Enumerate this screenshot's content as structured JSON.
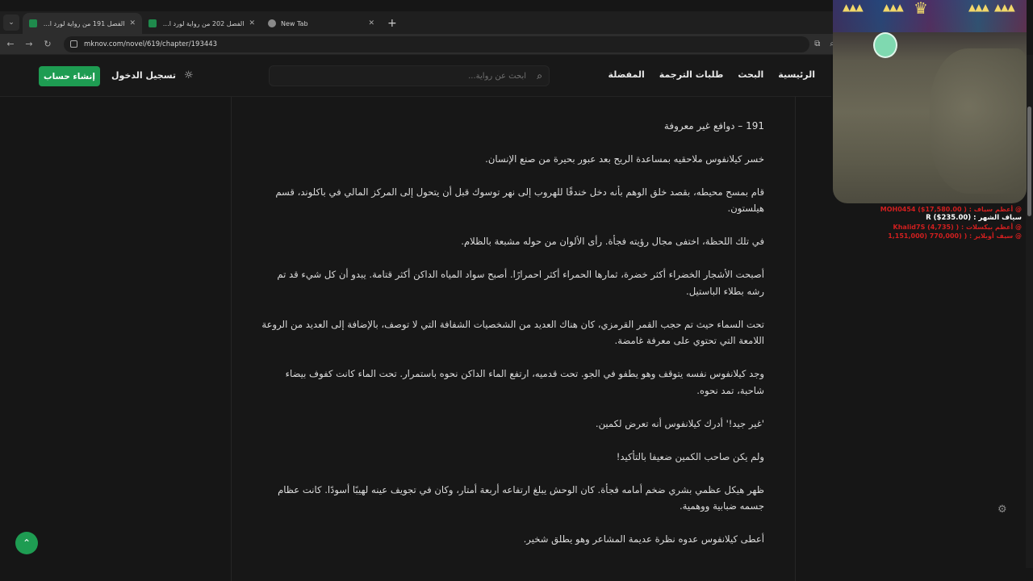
{
  "browser": {
    "tabs": [
      {
        "title": "الفصل 191 من رواية لورد الفوا...",
        "active": true
      },
      {
        "title": "الفصل 202 من رواية لورد الفوا...",
        "active": false
      },
      {
        "title": "New Tab",
        "active": false
      }
    ],
    "url": "mknov.com/novel/619/chapter/193443"
  },
  "header": {
    "menu": [
      "الرئيسية",
      "البحث",
      "طلبات الترجمة",
      "المفضلة"
    ],
    "search_placeholder": "ابحث عن رواية...",
    "login": "تسجيل الدخول",
    "register": "إنشاء حساب"
  },
  "chapter": {
    "title": "191 – دوافع غير معروفة",
    "paragraphs": [
      "خسر كيلانفوس ملاحقيه بمساعدة الريح بعد عبور بحيرة من صنع الإنسان.",
      "قام بمسح محيطه، بقصد خلق الوهم بأنه دخل خندقًا للهروب إلى نهر توسوك قبل أن يتحول إلى المركز المالي في باكلوند، قسم هيلستون.",
      "في تلك اللحظة، اختفى مجال رؤيته فجأة. رأى الألوان من حوله مشبعة بالظلام.",
      "أصبحت الأشجار الخضراء أكثر خضرة، ثمارها الحمراء أكثر احمرارًا. أصبح سواد المياه الداكن أكثر قتامة. يبدو أن كل شيء قد تم رشه بطلاء الباستيل.",
      "تحت السماء حيث تم حجب القمر القرمزي، كان هناك العديد من الشخصيات الشفافة التي لا توصف، بالإضافة إلى العديد من الروعة اللامعة التي تحتوي على معرفة غامضة.",
      "وجد كيلانفوس نفسه يتوقف وهو يطفو في الجو. تحت قدميه، ارتفع الماء الداكن نحوه باستمرار. تحت الماء كانت كفوف بيضاء شاحبة، تمد نحوه.",
      "'غير جيد!' أدرك كيلانفوس أنه تعرض لكمين.",
      "ولم يكن صاحب الكمين ضعيفا بالتأكيد!",
      "ظهر هيكل عظمي بشري ضخم أمامه فجأة. كان الوحش يبلغ ارتفاعه أربعة أمتار، وكان في تجويف عينه لهيبًا أسودًا. كانت عظام جسمه ضبابية ووهمية.",
      "أعطى كيلانفوس عدوه نظرة عديمة المشاعر وهو يطلق شخير."
    ]
  },
  "overlay": {
    "donors": [
      {
        "text": "@ أعظم سياف : ( MOH0454 ($17,580.00",
        "color": "red"
      },
      {
        "text": "سياف الشهر : (R ($235.00",
        "color": "white"
      },
      {
        "text": "@ أعظم بيكسلات : ( (Khalid7S (4,735",
        "color": "red"
      },
      {
        "text": "@ سيف أوبلاير : ( (770,000 (1,151,000",
        "color": "red"
      }
    ]
  },
  "colors": {
    "accent": "#1e9c52",
    "background": "#161616",
    "text": "#dcdcdc"
  },
  "icons": {
    "theme": "sun-icon",
    "search": "search-icon",
    "settings": "gear-icon",
    "scroll_top": "chevron-up-icon"
  }
}
